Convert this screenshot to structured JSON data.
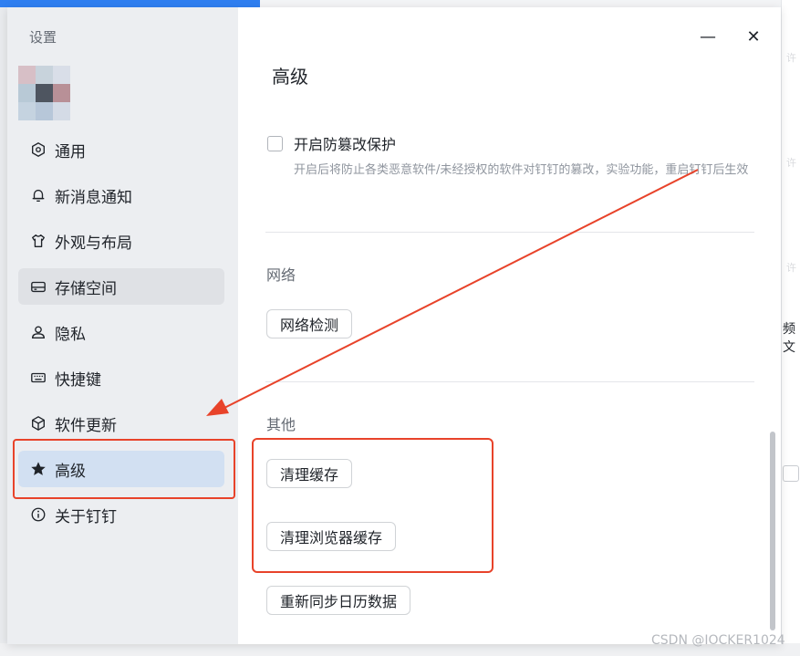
{
  "background": {
    "right_text": "频文",
    "watermark_text": "许"
  },
  "sidebar": {
    "title": "设置",
    "items": [
      {
        "label": "通用",
        "icon": "hexagon-settings-icon"
      },
      {
        "label": "新消息通知",
        "icon": "bell-icon"
      },
      {
        "label": "外观与布局",
        "icon": "shirt-icon"
      },
      {
        "label": "存储空间",
        "icon": "storage-icon"
      },
      {
        "label": "隐私",
        "icon": "person-icon"
      },
      {
        "label": "快捷键",
        "icon": "keyboard-icon"
      },
      {
        "label": "软件更新",
        "icon": "cube-icon"
      },
      {
        "label": "高级",
        "icon": "star-icon"
      },
      {
        "label": "关于钉钉",
        "icon": "info-icon"
      }
    ],
    "active_label": "高级"
  },
  "window": {
    "minimize": "—",
    "close": "✕"
  },
  "main": {
    "title": "高级",
    "tamper": {
      "label": "开启防篡改保护",
      "description": "开启后将防止各类恶意软件/未经授权的软件对钉钉的篡改，实验功能，重启钉钉后生效",
      "checked": false
    },
    "network": {
      "title": "网络",
      "button": "网络检测"
    },
    "other": {
      "title": "其他",
      "buttons": [
        "清理缓存",
        "清理浏览器缓存",
        "重新同步日历数据"
      ]
    }
  },
  "annotation_color": "#e8432a",
  "watermark": "CSDN @IOCKER1024"
}
